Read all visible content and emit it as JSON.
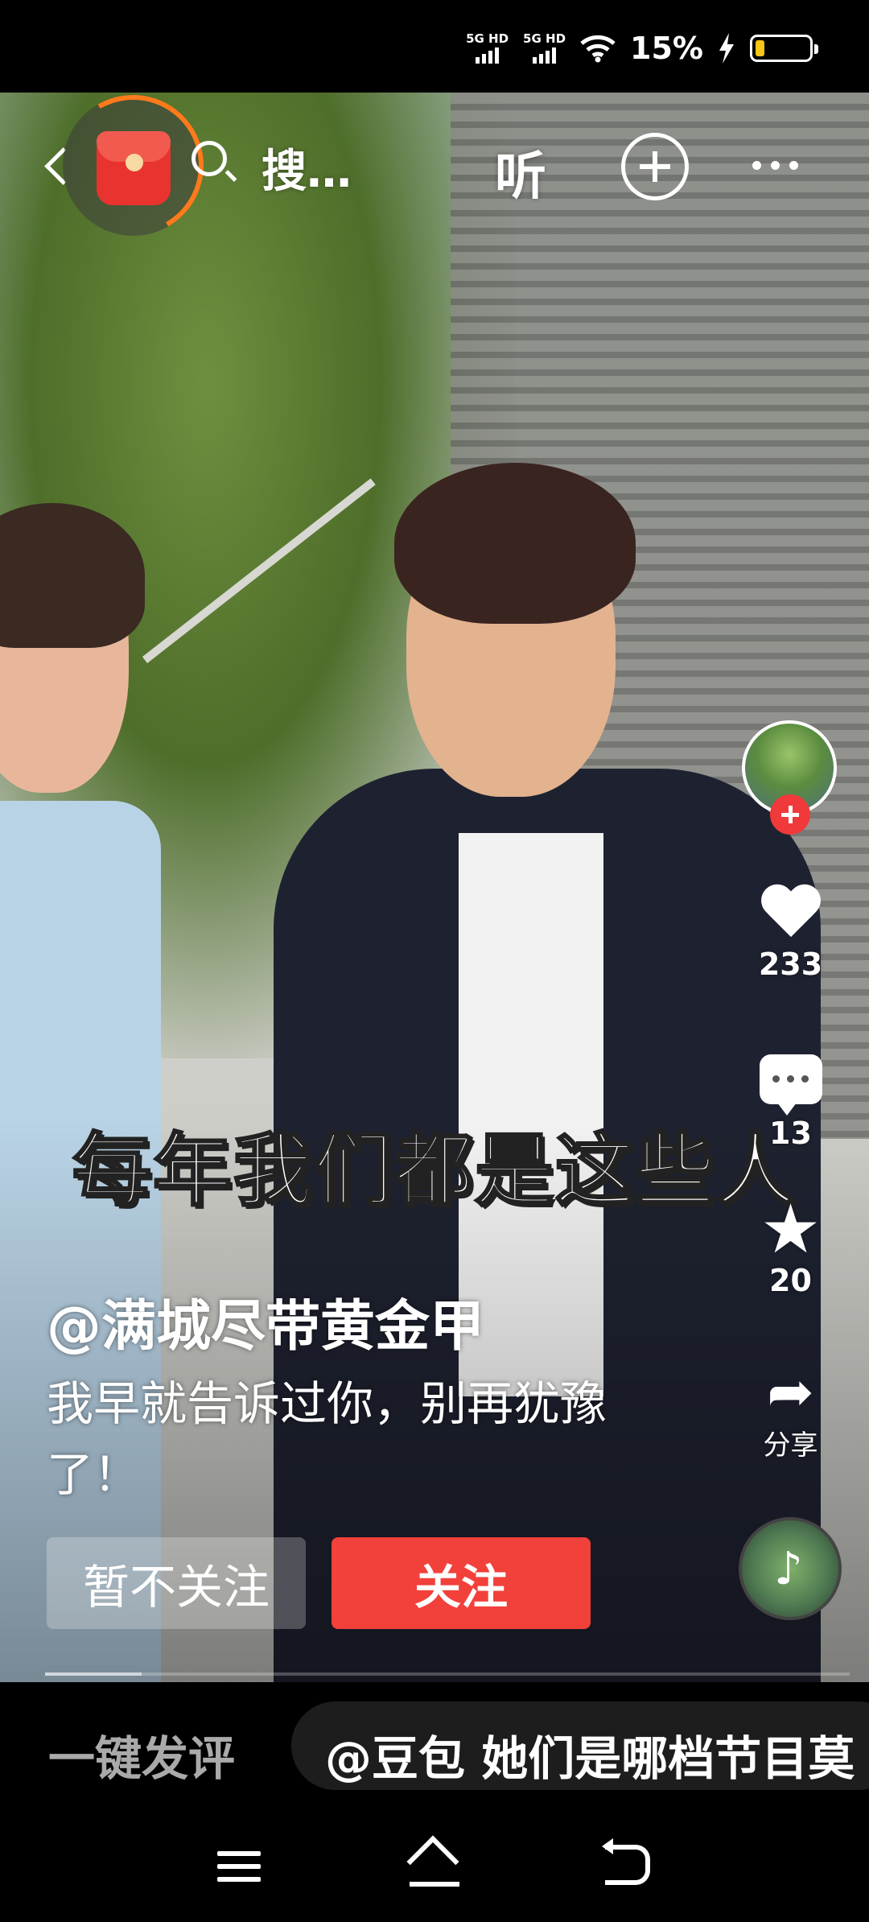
{
  "status_bar": {
    "network_1": "5G HD",
    "network_2": "5G HD",
    "wifi_icon": "wifi-icon",
    "battery_percent": "15%",
    "charging_icon": "bolt-icon",
    "battery_level": 0.15,
    "battery_fill_color": "#f5c518"
  },
  "top_bar": {
    "back_icon": "chevron-left-icon",
    "red_packet_icon": "red-packet-icon",
    "search_icon": "search-icon",
    "search_text": "搜…",
    "listen_label": "听",
    "add_icon": "plus-circle-icon",
    "more_icon": "more-dots-icon"
  },
  "video": {
    "subtitle": "每年我们都是这些人",
    "progress_fraction": 0.12
  },
  "sidebar": {
    "avatar_icon": "avatar",
    "follow_plus_icon": "plus-icon",
    "like_count": "233",
    "comment_count": "13",
    "favorite_count": "20",
    "share_label": "分享",
    "music_note_icon": "music-note-icon"
  },
  "caption": {
    "author": "@满城尽带黄金甲",
    "description": "我早就告诉过你，别再犹豫了！",
    "not_follow_label": "暂不关注",
    "follow_label": "关注",
    "follow_color": "#f2403b"
  },
  "comment_bar": {
    "quick_comment_label": "一键发评",
    "ask_text": "@豆包 她们是哪档节目莫"
  },
  "nav_bar": {
    "menu_icon": "menu-icon",
    "home_icon": "home-icon",
    "back_icon": "back-icon"
  }
}
